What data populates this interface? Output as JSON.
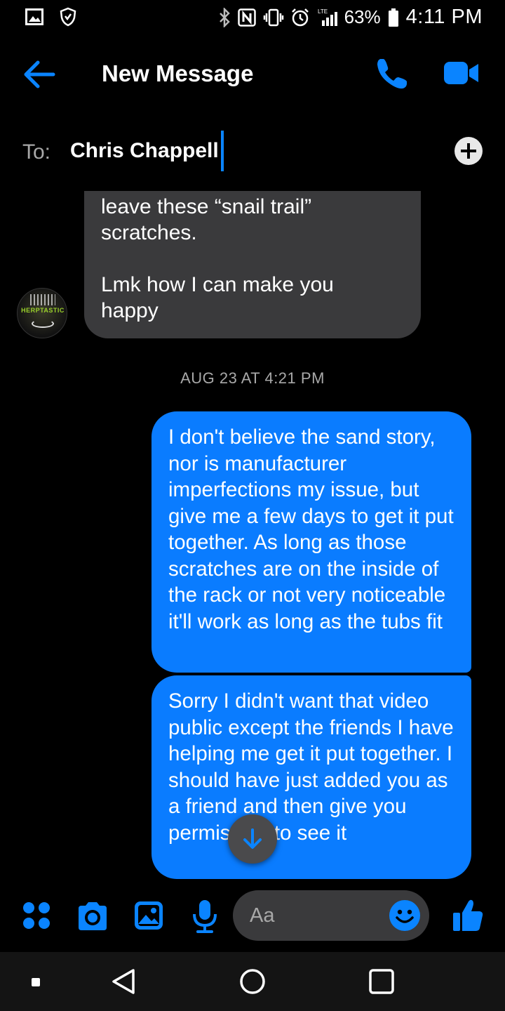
{
  "status_bar": {
    "battery_percent": "63%",
    "time": "4:11 PM",
    "icons": [
      "gallery-icon",
      "shield-icon",
      "bluetooth-icon",
      "nfc-icon",
      "vibrate-icon",
      "alarm-icon",
      "lte-signal-icon",
      "battery-icon"
    ]
  },
  "header": {
    "title": "New Message"
  },
  "to_row": {
    "label": "To:",
    "recipient": "Chris Chappell"
  },
  "thread": {
    "incoming_lines": [
      "leave these “snail trail”",
      "scratches.",
      "Lmk how I can make you",
      "happy"
    ],
    "avatar_text": "HERPTASTIC",
    "timestamp": "AUG 23 AT 4:21 PM",
    "outgoing": [
      {
        "text": "I don't believe the sand story, nor is manufacturer imperfections my issue, but give me a few days to get it put together. As long as those scratches are on the inside of the rack or not very noticeable it'll work as long as the tubs fit"
      },
      {
        "text": "Sorry I didn't want that video public except the friends I have helping me get it put together. I should have just added you as a friend and then give you permission to see it"
      }
    ]
  },
  "composer": {
    "placeholder": "Aa",
    "accent": "#0a84ff"
  },
  "navbar": {
    "icons": [
      "square-dot-icon",
      "back-triangle-icon",
      "home-circle-icon",
      "recents-square-icon"
    ]
  }
}
